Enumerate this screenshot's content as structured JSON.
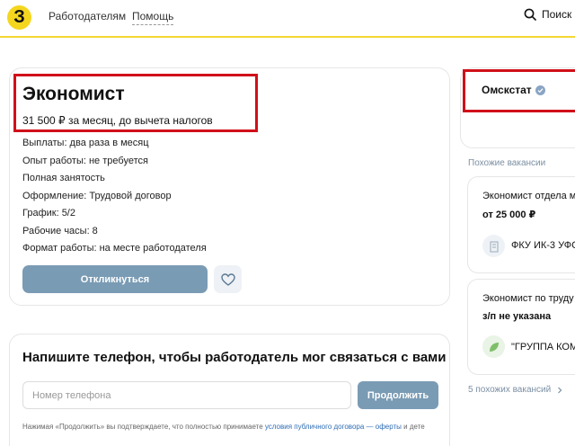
{
  "header": {
    "logo_text": "З",
    "nav": [
      "Работодателям",
      "Помощь"
    ],
    "search_label": "Поиск"
  },
  "vacancy": {
    "title": "Экономист",
    "salary": "31 500 ₽ за месяц, до вычета налогов",
    "details": [
      "Выплаты: два раза в месяц",
      "Опыт работы: не требуется",
      "Полная занятость",
      "Оформление: Трудовой договор",
      "График: 5/2",
      "Рабочие часы: 8",
      "Формат работы: на месте работодателя"
    ],
    "respond_label": "Откликнуться"
  },
  "phone_form": {
    "title": "Напишите телефон, чтобы работодатель мог связаться с вами",
    "placeholder": "Номер телефона",
    "continue_label": "Продолжить",
    "legal_text": "Нажимая «Продолжить» вы подтверждаете, что полностью принимаете ",
    "legal_link": "условия публичного договора — оферты",
    "legal_tail": " и дете"
  },
  "employer": {
    "name": "Омскстат"
  },
  "similar": {
    "label": "Похожие вакансии",
    "items": [
      {
        "title": "Экономист отдела м",
        "salary": "от 25 000 ₽",
        "company": "ФКУ ИК-3 УФС"
      },
      {
        "title": "Экономист по труду",
        "salary": "з/п не указана",
        "company": "\"ГРУППА КОМ"
      }
    ],
    "more_label": "5 похожих вакансий"
  },
  "colors": {
    "accent_yellow": "#f5d61e",
    "button_blue": "#7a9bb4",
    "highlight_red": "#d0101a",
    "link_blue": "#2f6db5"
  }
}
